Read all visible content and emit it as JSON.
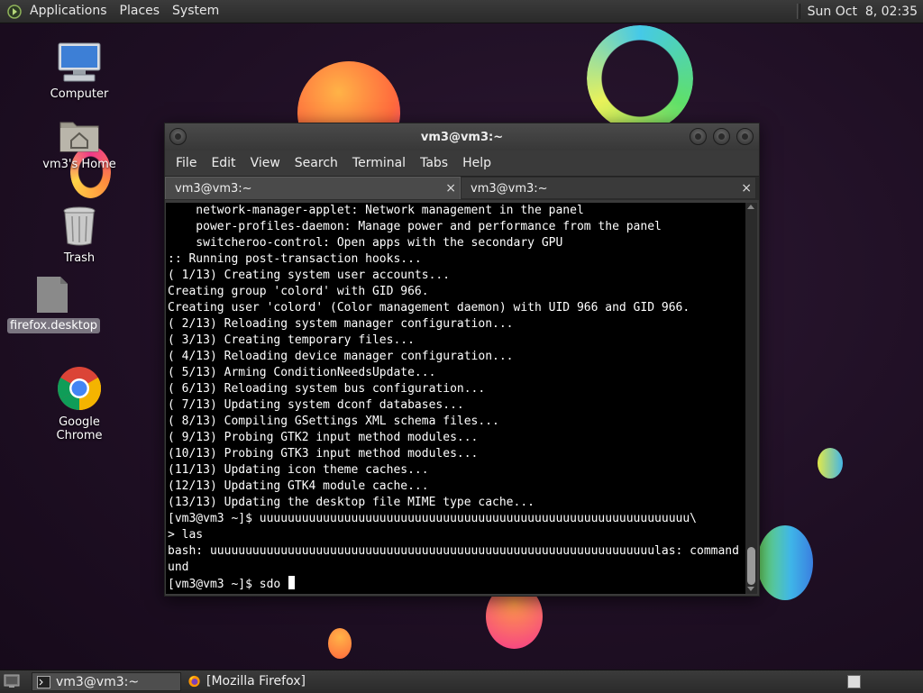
{
  "top_panel": {
    "menus": [
      "Applications",
      "Places",
      "System"
    ],
    "clock": "Sun Oct  8, 02:35"
  },
  "desktop_icons": [
    {
      "label": "Computer",
      "icon": "computer-icon"
    },
    {
      "label": "vm3's Home",
      "icon": "home-folder-icon"
    },
    {
      "label": "Trash",
      "icon": "trash-icon"
    },
    {
      "label": "firefox.desktop",
      "icon": "file-icon",
      "selected": true
    },
    {
      "label": "Google Chrome",
      "icon": "chrome-icon"
    }
  ],
  "terminal": {
    "title": "vm3@vm3:~",
    "menu": [
      "File",
      "Edit",
      "View",
      "Search",
      "Terminal",
      "Tabs",
      "Help"
    ],
    "tabs": [
      {
        "label": "vm3@vm3:~",
        "active": true
      },
      {
        "label": "vm3@vm3:~",
        "active": false
      }
    ],
    "tab_close": "×",
    "lines": [
      "    network-manager-applet: Network management in the panel",
      "    power-profiles-daemon: Manage power and performance from the panel",
      "    switcheroo-control: Open apps with the secondary GPU",
      ":: Running post-transaction hooks...",
      "( 1/13) Creating system user accounts...",
      "Creating group 'colord' with GID 966.",
      "Creating user 'colord' (Color management daemon) with UID 966 and GID 966.",
      "( 2/13) Reloading system manager configuration...",
      "( 3/13) Creating temporary files...",
      "( 4/13) Reloading device manager configuration...",
      "( 5/13) Arming ConditionNeedsUpdate...",
      "( 6/13) Reloading system bus configuration...",
      "( 7/13) Updating system dconf databases...",
      "( 8/13) Compiling GSettings XML schema files...",
      "( 9/13) Probing GTK2 input method modules...",
      "(10/13) Probing GTK3 input method modules...",
      "(11/13) Updating icon theme caches...",
      "(12/13) Updating GTK4 module cache...",
      "(13/13) Updating the desktop file MIME type cache...",
      "[vm3@vm3 ~]$ uuuuuuuuuuuuuuuuuuuuuuuuuuuuuuuuuuuuuuuuuuuuuuuuuuuuuuuuuuuuu\\",
      "> las",
      "bash: uuuuuuuuuuuuuuuuuuuuuuuuuuuuuuuuuuuuuuuuuuuuuuuuuuuuuuuuuuuuuuulas: command not fo",
      "und"
    ],
    "prompt_line": "[vm3@vm3 ~]$ sdo "
  },
  "taskbar": {
    "tasks": [
      {
        "label": "vm3@vm3:~",
        "icon": "terminal-icon",
        "active": true
      },
      {
        "label": "[Mozilla Firefox]",
        "icon": "firefox-icon",
        "active": false
      }
    ]
  }
}
